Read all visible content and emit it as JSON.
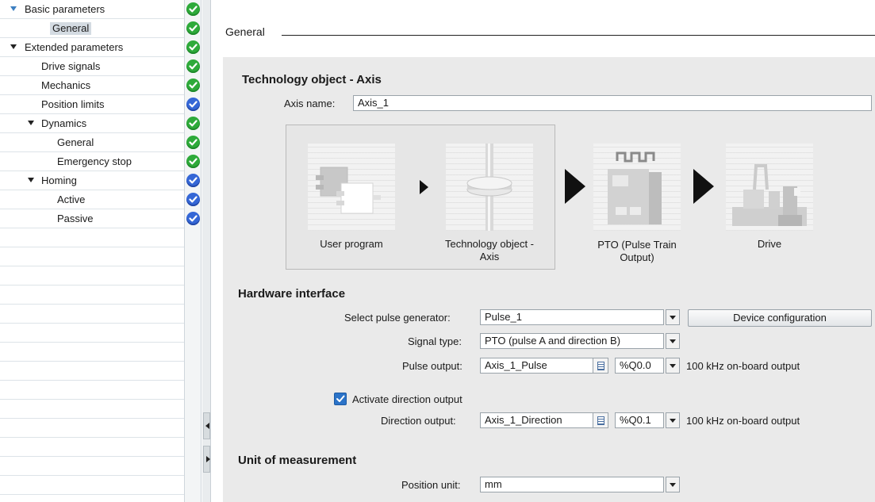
{
  "nav": {
    "items": [
      {
        "label": "Basic parameters",
        "status": "ok"
      },
      {
        "label": "General",
        "status": "ok"
      },
      {
        "label": "Extended parameters",
        "status": "ok"
      },
      {
        "label": "Drive signals",
        "status": "ok"
      },
      {
        "label": "Mechanics",
        "status": "ok"
      },
      {
        "label": "Position limits",
        "status": "info"
      },
      {
        "label": "Dynamics",
        "status": "ok"
      },
      {
        "label": "General",
        "status": "ok"
      },
      {
        "label": "Emergency stop",
        "status": "ok"
      },
      {
        "label": "Homing",
        "status": "info"
      },
      {
        "label": "Active",
        "status": "info"
      },
      {
        "label": "Passive",
        "status": "info"
      }
    ],
    "selected_index": 1
  },
  "section": {
    "title": "General"
  },
  "technology_object": {
    "heading": "Technology object - Axis",
    "axis_name_label": "Axis name:",
    "axis_name_value": "Axis_1"
  },
  "diagram": {
    "user_program": "User program",
    "technology_object_line1": "Technology object -",
    "technology_object_line2": "Axis",
    "pto_line1": "PTO (Pulse Train",
    "pto_line2": "Output)",
    "drive": "Drive"
  },
  "hardware": {
    "heading": "Hardware interface",
    "pulse_generator_label": "Select pulse generator:",
    "pulse_generator_value": "Pulse_1",
    "device_config_button": "Device configuration",
    "signal_type_label": "Signal type:",
    "signal_type_value": "PTO (pulse A and direction B)",
    "pulse_output_label": "Pulse output:",
    "pulse_output_value": "Axis_1_Pulse",
    "pulse_output_address": "%Q0.0",
    "pulse_output_note": "100 kHz on-board output",
    "activate_direction_label": "Activate direction output",
    "activate_direction_checked": true,
    "direction_output_label": "Direction output:",
    "direction_output_value": "Axis_1_Direction",
    "direction_output_address": "%Q0.1",
    "direction_output_note": "100 kHz on-board output"
  },
  "unit": {
    "heading": "Unit of measurement",
    "position_unit_label": "Position unit:",
    "position_unit_value": "mm"
  },
  "colors": {
    "status_ok": "#2eaa3a",
    "status_info": "#3567d6",
    "tree_arrow_blue": "#3d7fc1",
    "panel_background": "#eaeaea"
  }
}
